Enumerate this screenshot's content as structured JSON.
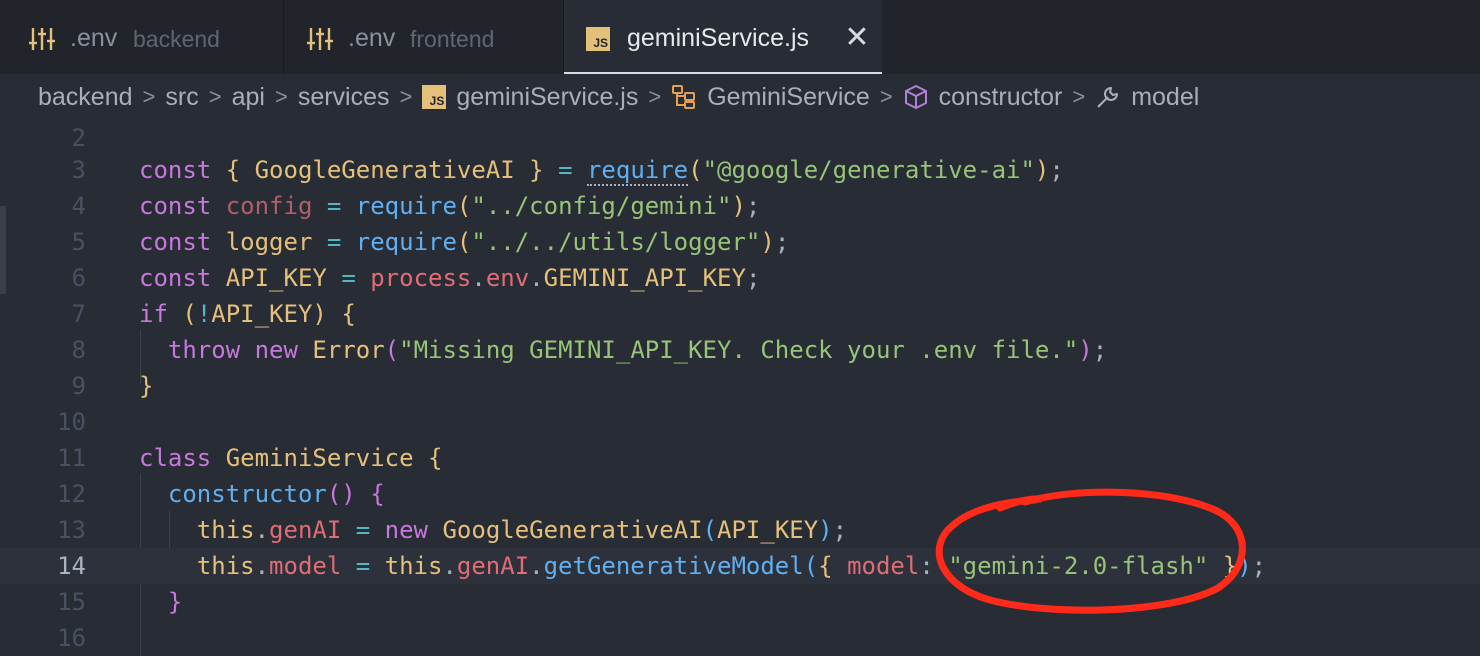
{
  "tabs": [
    {
      "name": ".env",
      "desc": "backend",
      "icon": "settings-sliders-icon",
      "active": false
    },
    {
      "name": ".env",
      "desc": "frontend",
      "icon": "settings-sliders-icon",
      "active": false
    },
    {
      "name": "geminiService.js",
      "icon": "js-file-icon",
      "active": true
    }
  ],
  "tab_close_glyph": "✕",
  "breadcrumb": {
    "items": [
      "backend",
      "src",
      "api",
      "services",
      "geminiService.js",
      "GeminiService",
      "constructor",
      "model"
    ],
    "separator": ">",
    "js_badge": "JS"
  },
  "editor": {
    "current_line": 14,
    "lines": [
      {
        "n": "2",
        "code": ""
      },
      {
        "n": "3",
        "code": "const { GoogleGenerativeAI } = require(\"@google/generative-ai\");"
      },
      {
        "n": "4",
        "code": "const config = require(\"../config/gemini\");"
      },
      {
        "n": "5",
        "code": "const logger = require(\"../../utils/logger\");"
      },
      {
        "n": "6",
        "code": "const API_KEY = process.env.GEMINI_API_KEY;"
      },
      {
        "n": "7",
        "code": "if (!API_KEY) {"
      },
      {
        "n": "8",
        "code": "  throw new Error(\"Missing GEMINI_API_KEY. Check your .env file.\");"
      },
      {
        "n": "9",
        "code": "}"
      },
      {
        "n": "10",
        "code": ""
      },
      {
        "n": "11",
        "code": "class GeminiService {"
      },
      {
        "n": "12",
        "code": "  constructor() {"
      },
      {
        "n": "13",
        "code": "    this.genAI = new GoogleGenerativeAI(API_KEY);"
      },
      {
        "n": "14",
        "code": "    this.model = this.genAI.getGenerativeModel({ model: \"gemini-2.0-flash\" });"
      },
      {
        "n": "15",
        "code": "  }"
      },
      {
        "n": "16",
        "code": ""
      }
    ]
  },
  "annotation": {
    "shape": "hand-drawn-circle",
    "color": "#ff2a1a"
  }
}
